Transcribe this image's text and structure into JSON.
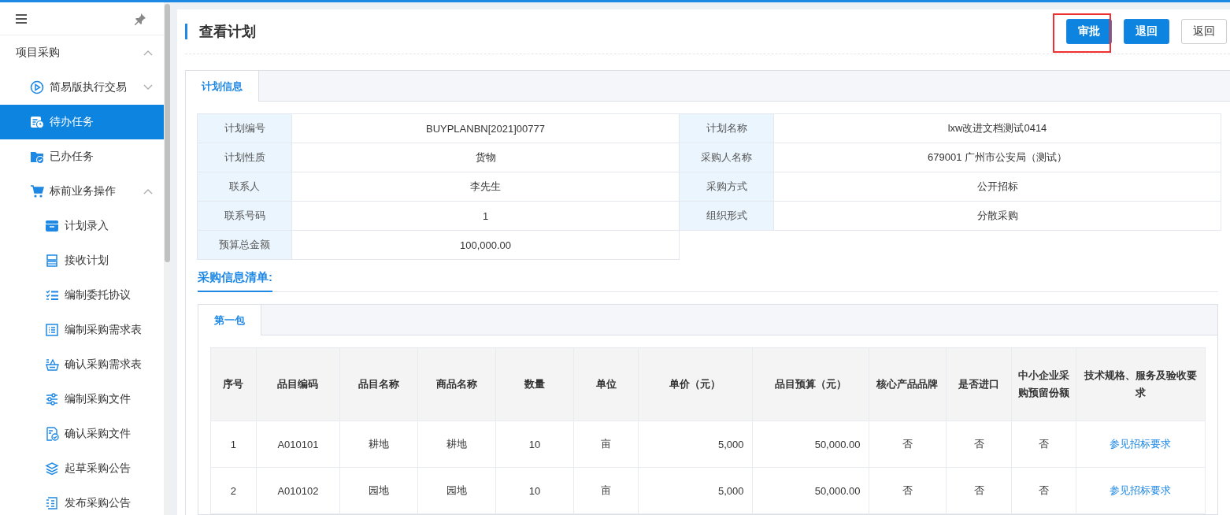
{
  "sidebar": {
    "items": [
      {
        "label": "项目采购",
        "expanded": true,
        "selected": false,
        "children": [
          {
            "label": "简易版执行交易",
            "expanded": false,
            "selected": false
          },
          {
            "label": "待办任务",
            "selected": true
          },
          {
            "label": "已办任务",
            "selected": false
          },
          {
            "label": "标前业务操作",
            "expanded": true,
            "selected": false,
            "children": [
              {
                "label": "计划录入",
                "selected": false
              },
              {
                "label": "接收计划",
                "selected": false
              },
              {
                "label": "编制委托协议",
                "selected": false
              },
              {
                "label": "编制采购需求表",
                "selected": false
              },
              {
                "label": "确认采购需求表",
                "selected": false
              },
              {
                "label": "编制采购文件",
                "selected": false
              },
              {
                "label": "确认采购文件",
                "selected": false
              },
              {
                "label": "起草采购公告",
                "selected": false
              },
              {
                "label": "发布采购公告",
                "selected": false
              }
            ]
          }
        ]
      }
    ]
  },
  "page": {
    "title": "查看计划",
    "buttons": [
      {
        "label": "审批",
        "kind": "primary",
        "highlighted": true
      },
      {
        "label": "退回",
        "kind": "primary",
        "highlighted": false
      },
      {
        "label": "返回",
        "kind": "default",
        "highlighted": false
      }
    ]
  },
  "tabs": [
    {
      "label": "计划信息",
      "selected": true
    }
  ],
  "plan_info": {
    "fields": [
      {
        "label": "计划编号",
        "value": "BUYPLANBN[2021]00777"
      },
      {
        "label": "计划名称",
        "value": "lxw改进文档测试0414"
      },
      {
        "label": "计划性质",
        "value": "货物"
      },
      {
        "label": "采购人名称",
        "value": "679001 广州市公安局（测试）"
      },
      {
        "label": "联系人",
        "value": "李先生"
      },
      {
        "label": "采购方式",
        "value": "公开招标"
      },
      {
        "label": "联系号码",
        "value": "1"
      },
      {
        "label": "组织形式",
        "value": "分散采购"
      },
      {
        "label": "预算总金额",
        "value": "100,000.00"
      }
    ]
  },
  "section_title": "采购信息清单:",
  "package_tabs": [
    {
      "label": "第一包",
      "selected": true
    }
  ],
  "table": {
    "columns": [
      {
        "label": "序号",
        "kind": "text"
      },
      {
        "label": "品目编码",
        "kind": "text"
      },
      {
        "label": "品目名称",
        "kind": "text"
      },
      {
        "label": "商品名称",
        "kind": "text"
      },
      {
        "label": "数量",
        "kind": "text"
      },
      {
        "label": "单位",
        "kind": "text"
      },
      {
        "label": "单价（元）",
        "kind": "amount"
      },
      {
        "label": "品目预算（元）",
        "kind": "amount"
      },
      {
        "label": "核心产品品牌",
        "kind": "text"
      },
      {
        "label": "是否进口",
        "kind": "text"
      },
      {
        "label": "中小企业采购预留份额",
        "kind": "text"
      },
      {
        "label": "技术规格、服务及验收要求",
        "kind": "link"
      }
    ],
    "rows": [
      [
        "1",
        "A010101",
        "耕地",
        "耕地",
        "10",
        "亩",
        "5,000",
        "50,000.00",
        "否",
        "否",
        "否",
        "参见招标要求"
      ],
      [
        "2",
        "A010102",
        "园地",
        "园地",
        "10",
        "亩",
        "5,000",
        "50,000.00",
        "否",
        "否",
        "否",
        "参见招标要求"
      ]
    ]
  }
}
